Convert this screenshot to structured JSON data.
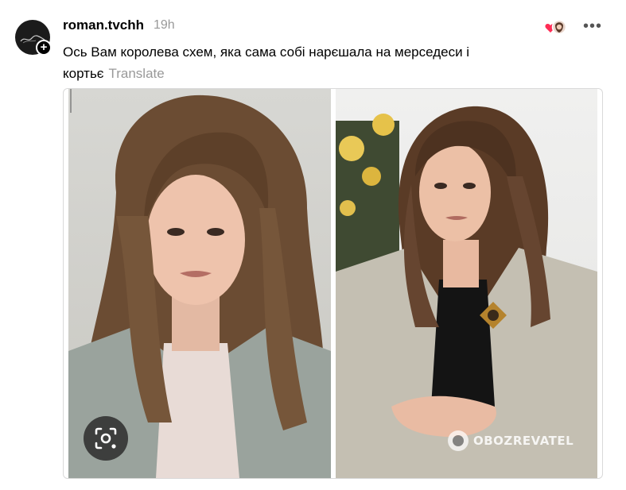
{
  "post": {
    "username": "roman.tvchh",
    "timestamp": "19h",
    "text": "Ось Вам королева схем, яка сама собі нарєшала на мерседеси і кортьє",
    "translate_label": "Translate",
    "more_label": "•••"
  },
  "image": {
    "watermark": "OBOZREVATEL"
  },
  "icons": {
    "avatar_add": "plus-icon",
    "reaction": "heart-reaction-icon",
    "more": "more-options-icon",
    "lens": "visual-search-icon"
  },
  "colors": {
    "username": "#000000",
    "muted": "#999999",
    "heart": "#ff2d55"
  }
}
